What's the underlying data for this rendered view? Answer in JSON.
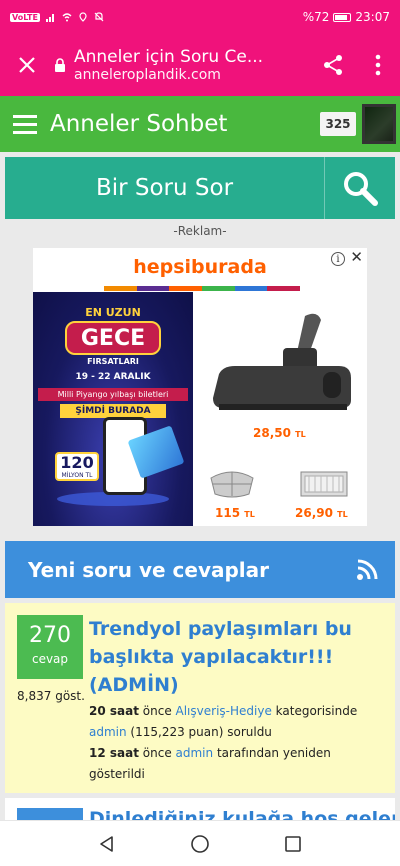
{
  "status": {
    "carrier_badge": "VoLTE",
    "battery": "%72",
    "time": "23:07"
  },
  "browser": {
    "page_title": "Anneler için Soru Ce...",
    "domain": "anneleroplandik.com",
    "close_icon": "close-icon",
    "share_icon": "share-icon",
    "more_icon": "more-vertical-icon"
  },
  "site": {
    "title": "Anneler Sohbet",
    "notification_count": "325"
  },
  "ask": {
    "label": "Bir Soru Sor"
  },
  "ad": {
    "label": "-Reklam-",
    "brand": "hepsiburada",
    "promo_top": "EN UZUN",
    "promo_main": "GECE",
    "promo_sub": "FIRSATLARI",
    "promo_date": "19 - 22 ARALIK",
    "promo_lottery": "Milli Piyango yılbaşı biletleri",
    "promo_now": "ŞİMDİ BURADA",
    "promo_amount": "120",
    "promo_amount_sub": "MİLYON TL",
    "price_main": "28,50",
    "price_small1": "115",
    "price_small2": "26,90",
    "currency": "TL",
    "colors": [
      "#f28a00",
      "#5a2d91",
      "#ff6000",
      "#3cb44b",
      "#2e76d6",
      "#c41d4c"
    ]
  },
  "news": {
    "title": "Yeni soru ve cevaplar",
    "rss_icon": "rss-icon"
  },
  "questions": [
    {
      "answers": "270",
      "answers_label": "cevap",
      "views": "8,837 göst.",
      "title": "Trendyol paylaşımları bu başlıkta yapılacaktır!!! (ADMİN)",
      "time1": "20 saat",
      "mid1": " önce ",
      "category": "Alışveriş-Hediye",
      "cat_suffix": " kategorisinde",
      "user": "admin",
      "points": " (115,223 puan) soruldu",
      "time2": "12 saat",
      "mid2": " önce ",
      "user2": "admin",
      "tail2": " tarafından yeniden gösterildi"
    },
    {
      "title": "Dinlediğiniz kulağa hoş gelen"
    }
  ]
}
